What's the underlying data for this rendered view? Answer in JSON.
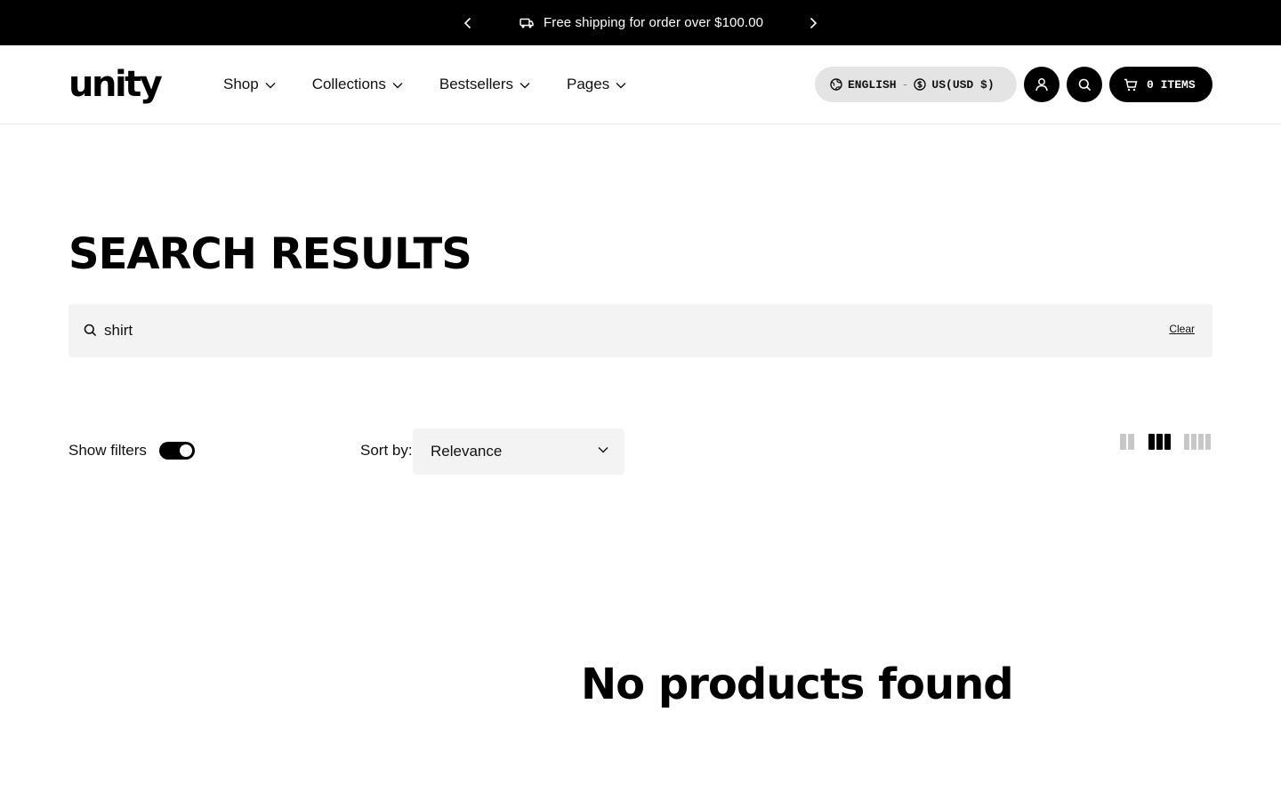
{
  "announcement": {
    "message": "Free shipping for order over $100.00",
    "prev_icon": "chevron-left-icon",
    "next_icon": "chevron-right-icon",
    "message_icon": "truck-icon"
  },
  "header": {
    "logo_text": "unity",
    "nav": [
      {
        "label": "Shop"
      },
      {
        "label": "Collections"
      },
      {
        "label": "Bestsellers"
      },
      {
        "label": "Pages"
      }
    ],
    "locale": {
      "language": "ENGLISH",
      "separator": "-",
      "currency": "US(USD $)"
    },
    "cart": {
      "count": "0",
      "label": "ITEMS"
    }
  },
  "main": {
    "title": "SEARCH RESULTS",
    "search": {
      "value": "shirt",
      "clear_label": "Clear"
    },
    "filters_label": "Show filters",
    "filters_on": true,
    "sort_label": "Sort by:",
    "sort_value": "Relevance",
    "grid_selected": 3,
    "empty_message": "No products found"
  },
  "colors": {
    "primary": "#000000",
    "surface": "#f3f3f3",
    "pill": "#e4e4e4",
    "inactive_icon": "#c7c7c7"
  }
}
